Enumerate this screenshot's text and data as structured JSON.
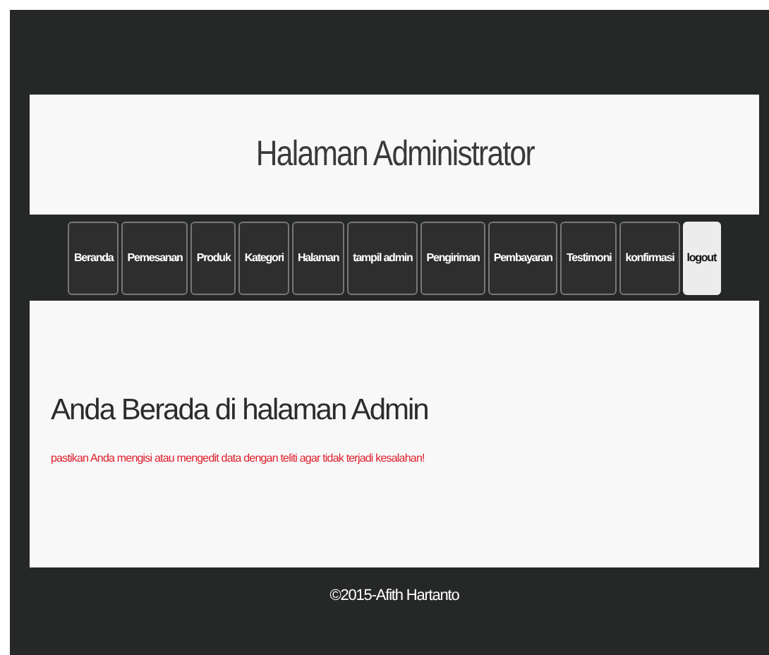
{
  "header": {
    "title": "Halaman Administrator"
  },
  "nav": [
    {
      "label": "Beranda",
      "selected": false
    },
    {
      "label": "Pemesanan",
      "selected": false
    },
    {
      "label": "Produk",
      "selected": false
    },
    {
      "label": "Kategori",
      "selected": false
    },
    {
      "label": "Halaman",
      "selected": false
    },
    {
      "label": "tampil admin",
      "selected": false
    },
    {
      "label": "Pengiriman",
      "selected": false
    },
    {
      "label": "Pembayaran",
      "selected": false
    },
    {
      "label": "Testimoni",
      "selected": false
    },
    {
      "label": "konfirmasi",
      "selected": false
    },
    {
      "label": "logout",
      "selected": true
    }
  ],
  "content": {
    "heading": "Anda Berada di halaman Admin",
    "notice": "pastikan Anda mengisi atau mengedit data dengan teliti agar tidak terjadi kesalahan!"
  },
  "footer": {
    "text": "©2015-Afith Hartanto"
  }
}
